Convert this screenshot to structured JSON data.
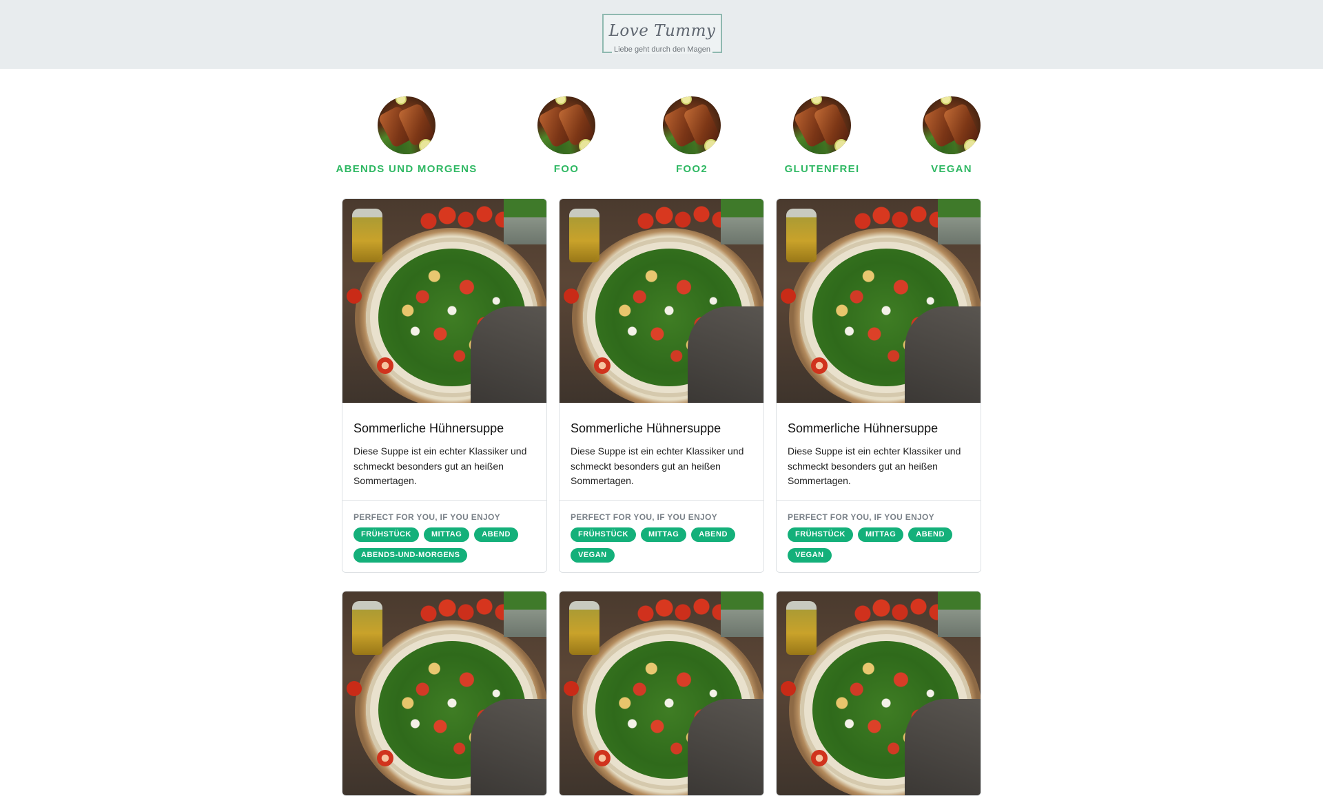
{
  "header": {
    "logo_title": "Love Tummy",
    "logo_subtitle": "Liebe geht durch den Magen"
  },
  "categories": [
    {
      "label": "ABENDS UND MORGENS",
      "image": "grilled-fish-photo"
    },
    {
      "label": "FOO",
      "image": "grilled-fish-photo"
    },
    {
      "label": "FOO2",
      "image": "grilled-fish-photo"
    },
    {
      "label": "GLUTENFREI",
      "image": "grilled-fish-photo"
    },
    {
      "label": "VEGAN",
      "image": "grilled-fish-photo"
    }
  ],
  "recipes": [
    {
      "image": "pasta-salad-photo",
      "title": "Sommerliche Hühnersuppe",
      "description": "Diese Suppe ist ein echter Klassiker und schmeckt besonders gut an heißen Sommertagen.",
      "footer_label": "PERFECT FOR YOU, IF YOU ENJOY",
      "tags": [
        "FRÜHSTÜCK",
        "MITTAG",
        "ABEND",
        "ABENDS-UND-MORGENS"
      ]
    },
    {
      "image": "pasta-salad-photo",
      "title": "Sommerliche Hühnersuppe",
      "description": "Diese Suppe ist ein echter Klassiker und schmeckt besonders gut an heißen Sommertagen.",
      "footer_label": "PERFECT FOR YOU, IF YOU ENJOY",
      "tags": [
        "FRÜHSTÜCK",
        "MITTAG",
        "ABEND",
        "VEGAN"
      ]
    },
    {
      "image": "pasta-salad-photo",
      "title": "Sommerliche Hühnersuppe",
      "description": "Diese Suppe ist ein echter Klassiker und schmeckt besonders gut an heißen Sommertagen.",
      "footer_label": "PERFECT FOR YOU, IF YOU ENJOY",
      "tags": [
        "FRÜHSTÜCK",
        "MITTAG",
        "ABEND",
        "VEGAN"
      ]
    },
    {
      "image": "pasta-salad-photo"
    },
    {
      "image": "pasta-salad-photo"
    },
    {
      "image": "pasta-salad-photo"
    }
  ],
  "colors": {
    "header_bg": "#e8ecee",
    "category_label": "#2fb863",
    "tag_bg": "#14b07a",
    "footer_label": "#7a8188"
  }
}
